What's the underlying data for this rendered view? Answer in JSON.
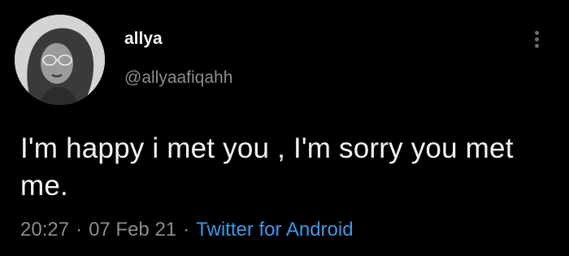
{
  "tweet": {
    "author": {
      "display_name": "allya",
      "handle": "@allyaafiqahh"
    },
    "text": "I'm happy i met you , I'm sorry you met me.",
    "time": "20:27",
    "separator": "·",
    "date": "07 Feb 21",
    "source": "Twitter for Android"
  },
  "icons": {
    "more": "more-vertical-icon"
  },
  "colors": {
    "background": "#000000",
    "primary_text": "#f4f4f4",
    "secondary_text": "#8c8c8c",
    "link": "#3f98e6"
  }
}
